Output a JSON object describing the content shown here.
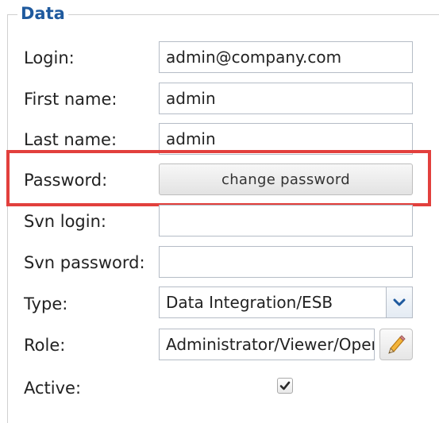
{
  "fieldset": {
    "legend": "Data"
  },
  "fields": {
    "login": {
      "label": "Login:",
      "value": "admin@company.com"
    },
    "first_name": {
      "label": "First name:",
      "value": "admin"
    },
    "last_name": {
      "label": "Last name:",
      "value": "admin"
    },
    "password": {
      "label": "Password:",
      "button_label": "change password"
    },
    "svn_login": {
      "label": "Svn login:",
      "value": ""
    },
    "svn_password": {
      "label": "Svn password:",
      "value": ""
    },
    "type": {
      "label": "Type:",
      "value": "Data Integration/ESB",
      "icon": "chevron-down-icon"
    },
    "role": {
      "label": "Role:",
      "value": "Administrator/Viewer/Operation Manager",
      "icon": "pencil-icon"
    },
    "active": {
      "label": "Active:",
      "checked": true,
      "icon": "checkmark-icon"
    }
  },
  "colors": {
    "legend": "#1f5a9e",
    "highlight": "#e2403d",
    "chevron": "#1f5a9e",
    "pencil": "#e8a21c"
  }
}
